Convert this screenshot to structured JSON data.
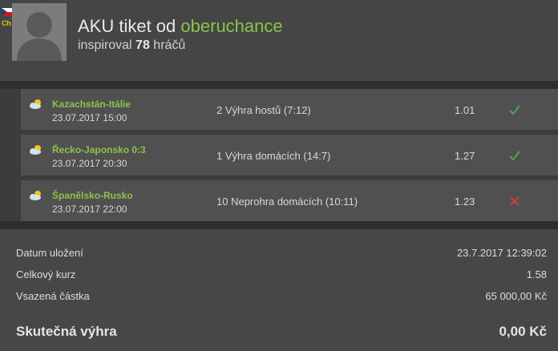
{
  "header": {
    "title_prefix": "AKU tiket od",
    "username": "oberuchance",
    "subtitle_prefix": "inspiroval",
    "players_count": "78",
    "subtitle_suffix": "hráčů",
    "badge": "Ch",
    "flag_icon": "czech-flag-icon"
  },
  "bets": [
    {
      "match": "Kazachstán-Itálie",
      "date": "23.07.2017 15:00",
      "tip": "2 Výhra hostů (7:12)",
      "odds": "1.01",
      "result": "won",
      "icon": "weather-icon"
    },
    {
      "match": "Řecko-Japonsko 0:3",
      "date": "23.07.2017 20:30",
      "tip": "1 Výhra domácích (14:7)",
      "odds": "1.27",
      "result": "won",
      "icon": "weather-icon"
    },
    {
      "match": "Španělsko-Rusko",
      "date": "23.07.2017 22:00",
      "tip": "10 Neprohra domácích (10:11)",
      "odds": "1.23",
      "result": "lost",
      "icon": "weather-icon"
    }
  ],
  "summary": {
    "saved_label": "Datum uložení",
    "saved_value": "23.7.2017 12:39:02",
    "total_odds_label": "Celkový kurz",
    "total_odds_value": "1.58",
    "stake_label": "Vsazená částka",
    "stake_value": "65 000,00 Kč",
    "win_label": "Skutečná výhra",
    "win_value": "0,00 Kč"
  },
  "colors": {
    "accent": "#8bc34a",
    "won": "#4caf50",
    "lost": "#e53935",
    "background": "#3c3c3c"
  }
}
